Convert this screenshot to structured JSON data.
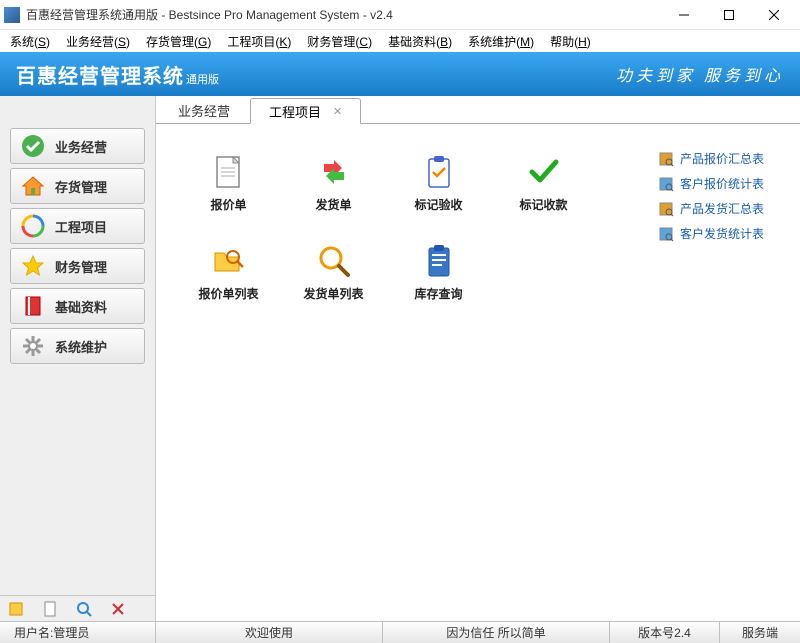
{
  "titlebar": {
    "title": "百惠经营管理系统通用版 - Bestsince Pro Management System - v2.4"
  },
  "menubar": {
    "items": [
      {
        "label": "系统",
        "key": "S"
      },
      {
        "label": "业务经营",
        "key": "S"
      },
      {
        "label": "存货管理",
        "key": "G"
      },
      {
        "label": "工程项目",
        "key": "K"
      },
      {
        "label": "财务管理",
        "key": "C"
      },
      {
        "label": "基础资料",
        "key": "B"
      },
      {
        "label": "系统维护",
        "key": "M"
      },
      {
        "label": "帮助",
        "key": "H"
      }
    ]
  },
  "banner": {
    "title": "百惠经营管理系统",
    "subtitle": "通用版",
    "slogan": "功夫到家 服务到心"
  },
  "sidebar": {
    "items": [
      {
        "label": "业务经营",
        "icon": "check-green"
      },
      {
        "label": "存货管理",
        "icon": "house"
      },
      {
        "label": "工程项目",
        "icon": "recycle"
      },
      {
        "label": "财务管理",
        "icon": "star-gold"
      },
      {
        "label": "基础资料",
        "icon": "book-red"
      },
      {
        "label": "系统维护",
        "icon": "gear"
      }
    ]
  },
  "tabs": [
    {
      "label": "业务经营",
      "active": false
    },
    {
      "label": "工程项目",
      "active": true
    }
  ],
  "apps": [
    {
      "label": "报价单",
      "icon": "doc"
    },
    {
      "label": "发货单",
      "icon": "arrows"
    },
    {
      "label": "标记验收",
      "icon": "clipboard"
    },
    {
      "label": "标记收款",
      "icon": "check"
    },
    {
      "label": "报价单列表",
      "icon": "folder-search"
    },
    {
      "label": "发货单列表",
      "icon": "magnify"
    },
    {
      "label": "库存查询",
      "icon": "clipboard-blue"
    }
  ],
  "rightpanel": {
    "items": [
      {
        "label": "产品报价汇总表",
        "color": "#e0a030"
      },
      {
        "label": "客户报价统计表",
        "color": "#5aa5e0"
      },
      {
        "label": "产品发货汇总表",
        "color": "#e0a030"
      },
      {
        "label": "客户发货统计表",
        "color": "#5aa5e0"
      }
    ]
  },
  "statusbar": {
    "user": "用户名:管理员",
    "welcome": "欢迎使用",
    "slogan": "因为信任 所以简单",
    "version": "版本号2.4",
    "server": "服务端"
  }
}
